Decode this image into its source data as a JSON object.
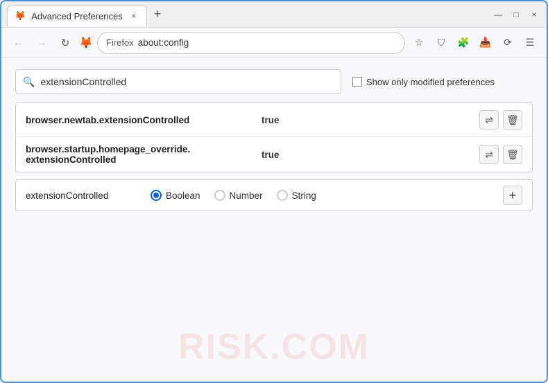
{
  "window": {
    "title": "Advanced Preferences",
    "tab_close": "×",
    "tab_new": "+",
    "controls": {
      "minimize": "—",
      "maximize": "□",
      "close": "×"
    }
  },
  "nav": {
    "back_label": "←",
    "forward_label": "→",
    "reload_label": "↻",
    "firefox_icon": "🦊",
    "site_name": "Firefox",
    "address": "about:config",
    "bookmark_icon": "☆",
    "shield_icon": "⛉",
    "extension_icon": "🧩",
    "download_icon": "📥",
    "sync_icon": "⟳",
    "menu_icon": "☰"
  },
  "search": {
    "placeholder": "extensionControlled",
    "value": "extensionControlled",
    "show_modified_label": "Show only modified preferences"
  },
  "results": [
    {
      "name": "browser.newtab.extensionControlled",
      "value": "true"
    },
    {
      "name": "browser.startup.homepage_override.\nextensionControlled",
      "name_line1": "browser.startup.homepage_override.",
      "name_line2": "extensionControlled",
      "value": "true"
    }
  ],
  "add_pref": {
    "name": "extensionControlled",
    "types": [
      {
        "id": "boolean",
        "label": "Boolean",
        "selected": true
      },
      {
        "id": "number",
        "label": "Number",
        "selected": false
      },
      {
        "id": "string",
        "label": "String",
        "selected": false
      }
    ],
    "add_label": "+"
  },
  "watermark": {
    "text": "RISK.COM"
  },
  "icons": {
    "search": "🔍",
    "swap": "⇌",
    "trash": "🗑",
    "plus": "+"
  }
}
